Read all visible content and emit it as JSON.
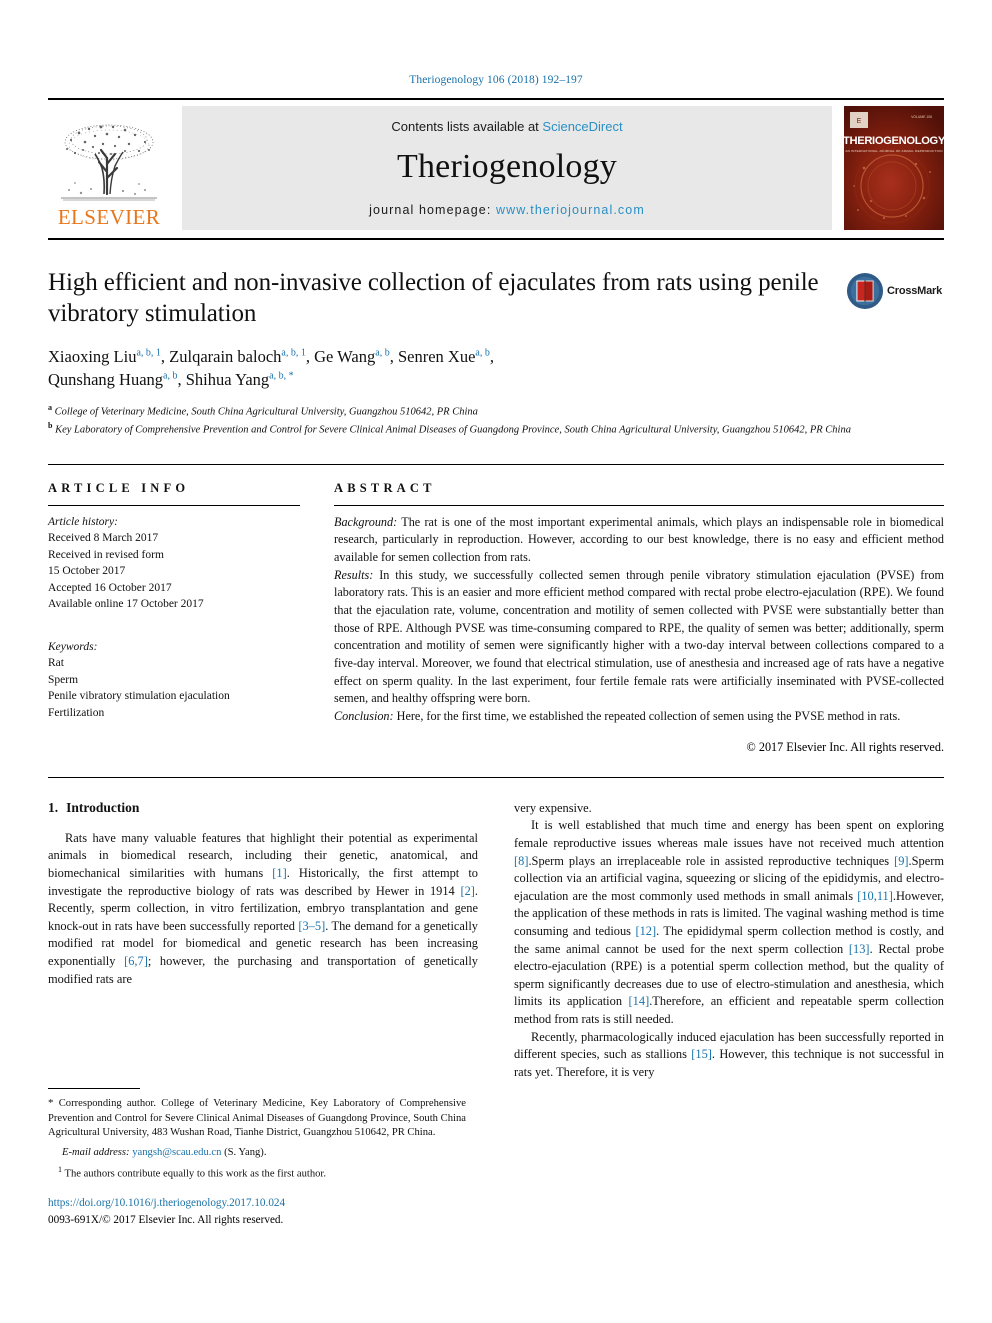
{
  "running_head": "Theriogenology 106 (2018) 192–197",
  "masthead": {
    "publisher_name": "ELSEVIER",
    "contents_prefix": "Contents lists available at ",
    "contents_link": "ScienceDirect",
    "journal_name": "Theriogenology",
    "homepage_prefix": "journal homepage: ",
    "homepage_url": "www.theriojournal.com",
    "cover_title": "THERIOGENOLOGY",
    "cover_subtitle": "AN INTERNATIONAL JOURNAL OF ANIMAL REPRODUCTION"
  },
  "article": {
    "title": "High efficient and non-invasive collection of ejaculates from rats using penile vibratory stimulation",
    "crossmark_label": "CrossMark",
    "authors_line_1": "Xiaoxing Liu",
    "authors": [
      {
        "name": "Xiaoxing Liu",
        "sup": "a, b, 1"
      },
      {
        "name": "Zulqarain baloch",
        "sup": "a, b, 1"
      },
      {
        "name": "Ge Wang",
        "sup": "a, b"
      },
      {
        "name": "Senren Xue",
        "sup": "a, b"
      },
      {
        "name": "Qunshang Huang",
        "sup": "a, b"
      },
      {
        "name": "Shihua Yang",
        "sup": "a, b, *"
      }
    ],
    "affiliations": [
      {
        "marker": "a",
        "text": "College of Veterinary Medicine, South China Agricultural University, Guangzhou 510642, PR China"
      },
      {
        "marker": "b",
        "text": "Key Laboratory of Comprehensive Prevention and Control for Severe Clinical Animal Diseases of Guangdong Province, South China Agricultural University, Guangzhou 510642, PR China"
      }
    ]
  },
  "article_info": {
    "heading": "ARTICLE INFO",
    "history_label": "Article history:",
    "history": [
      "Received 8 March 2017",
      "Received in revised form",
      "15 October 2017",
      "Accepted 16 October 2017",
      "Available online 17 October 2017"
    ],
    "keywords_label": "Keywords:",
    "keywords": [
      "Rat",
      "Sperm",
      "Penile vibratory stimulation ejaculation",
      "Fertilization"
    ]
  },
  "abstract": {
    "heading": "ABSTRACT",
    "sections": [
      {
        "label": "Background:",
        "text": " The rat is one of the most important experimental animals, which plays an indispensable role in biomedical research, particularly in reproduction. However, according to our best knowledge, there is no easy and efficient method available for semen collection from rats."
      },
      {
        "label": "Results:",
        "text": " In this study, we successfully collected semen through penile vibratory stimulation ejaculation (PVSE) from laboratory rats. This is an easier and more efficient method compared with rectal probe electro-ejaculation (RPE). We found that the ejaculation rate, volume, concentration and motility of semen collected with PVSE were substantially better than those of RPE. Although PVSE was time-consuming compared to RPE, the quality of semen was better; additionally, sperm concentration and motility of semen were significantly higher with a two-day interval between collections compared to a five-day interval. Moreover, we found that electrical stimulation, use of anesthesia and increased age of rats have a negative effect on sperm quality. In the last experiment, four fertile female rats were artificially inseminated with PVSE-collected semen, and healthy offspring were born."
      },
      {
        "label": "Conclusion:",
        "text": " Here, for the first time, we established the repeated collection of semen using the PVSE method in rats."
      }
    ],
    "copyright": "© 2017 Elsevier Inc. All rights reserved."
  },
  "introduction": {
    "number": "1.",
    "heading": "Introduction",
    "left_paragraphs": [
      "Rats have many valuable features that highlight their potential as experimental animals in biomedical research, including their genetic, anatomical, and biomechanical similarities with humans [1]. Historically, the first attempt to investigate the reproductive biology of rats was described by Hewer in 1914 [2]. Recently, sperm collection, in vitro fertilization, embryo transplantation and gene knock-out in rats have been successfully reported [3–5]. The demand for a genetically modified rat model for biomedical and genetic research has been increasing exponentially [6,7]; however, the purchasing and transportation of genetically modified rats are"
    ],
    "right_paragraphs": [
      "very expensive.",
      "It is well established that much time and energy has been spent on exploring female reproductive issues whereas male issues have not received much attention [8].Sperm plays an irreplaceable role in assisted reproductive techniques [9].Sperm collection via an artificial vagina, squeezing or slicing of the epididymis, and electro-ejaculation are the most commonly used methods in small animals [10,11].However, the application of these methods in rats is limited. The vaginal washing method is time consuming and tedious [12]. The epididymal sperm collection method is costly, and the same animal cannot be used for the next sperm collection [13]. Rectal probe electro-ejaculation (RPE) is a potential sperm collection method, but the quality of sperm significantly decreases due to use of electro-stimulation and anesthesia, which limits its application [14].Therefore, an efficient and repeatable sperm collection method from rats is still needed.",
      "Recently, pharmacologically induced ejaculation has been successfully reported in different species, such as stallions [15]. However, this technique is not successful in rats yet. Therefore, it is very"
    ]
  },
  "footnotes": {
    "corresponding": "Corresponding author. College of Veterinary Medicine, Key Laboratory of Comprehensive Prevention and Control for Severe Clinical Animal Diseases of Guangdong Province, South China Agricultural University, 483 Wushan Road, Tianhe District, Guangzhou 510642, PR China.",
    "email_label": "E-mail address:",
    "email": "yangsh@scau.edu.cn",
    "email_author": "(S. Yang).",
    "equal_contribution_marker": "1",
    "equal_contribution": "The authors contribute equally to this work as the first author."
  },
  "publisher_footer": {
    "doi": "https://doi.org/10.1016/j.theriogenology.2017.10.024",
    "issn_copyright": "0093-691X/© 2017 Elsevier Inc. All rights reserved."
  },
  "colors": {
    "link": "#1a72a8",
    "sciencedirect": "#2a8fc4",
    "elsevier_orange": "#e8761b",
    "cover_red": "#7d1d15"
  }
}
